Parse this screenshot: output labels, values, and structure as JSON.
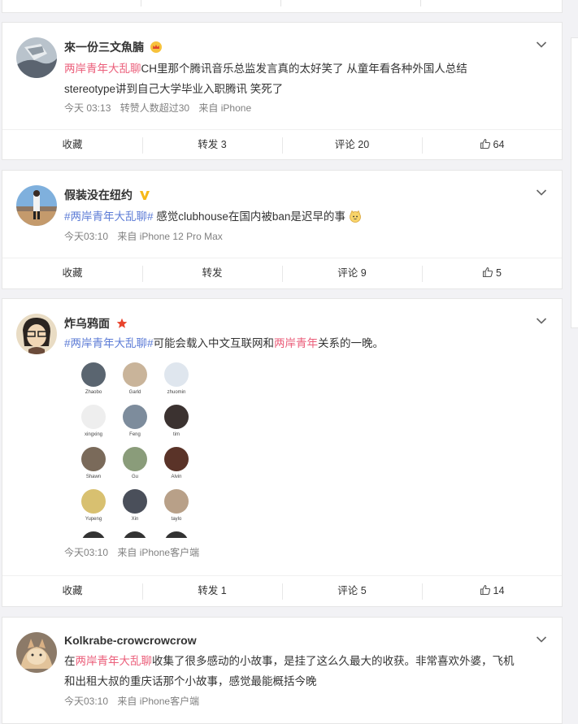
{
  "posts": [
    {
      "user": "來一份三文魚腩",
      "text_tag": "两岸青年大乱聊",
      "text_line1": "CH里那个腾讯音乐总监发言真的太好笑了 从童年看各种外国人总结",
      "text_line2": "stereotype讲到自己大学毕业入职腾讯 笑死了",
      "time": "今天 03:13",
      "extra": "转赞人数超过30",
      "source": "来自 iPhone",
      "actions": {
        "fav": "收藏",
        "repost": "转发 3",
        "comment": "评论 20",
        "like": "64"
      }
    },
    {
      "user": "假装没在纽约",
      "tag_full": "#两岸青年大乱聊#",
      "text": " 感觉clubhouse在国内被ban是迟早的事",
      "time": "今天03:10",
      "source": "来自 iPhone 12 Pro Max",
      "actions": {
        "fav": "收藏",
        "repost": "转发",
        "comment": "评论 9",
        "like": "5"
      }
    },
    {
      "user": "炸乌鸦面",
      "tag_full": "#两岸青年大乱聊#",
      "text_a": "可能会载入中文互联网和",
      "tag2": "两岸青年",
      "text_b": "关系的一晚。",
      "grid_names": [
        "Zhaobo",
        "Garld",
        "zhuomin",
        "xingxing",
        "Feng",
        "tim",
        "Shawn",
        "Gu",
        "Alvin",
        "Yupeng",
        "Xin",
        "taylo"
      ],
      "time": "今天03:10",
      "source": "来自 iPhone客户端",
      "actions": {
        "fav": "收藏",
        "repost": "转发 1",
        "comment": "评论 5",
        "like": "14"
      }
    },
    {
      "user": "Kolkrabe-crowcrowcrow",
      "text_a": "在",
      "tag": "两岸青年大乱聊",
      "text_b": "收集了很多感动的小故事，是挂了这么久最大的收获。非常喜欢外婆，飞机",
      "text_line2": "和出租大叔的重庆话那个小故事，感觉最能概括今晚",
      "time": "今天03:10",
      "source": "来自 iPhone客户端"
    }
  ],
  "icons": {
    "expand": "chevron-down-icon",
    "like": "thumbs-up-icon",
    "vip_gold": "crown-icon",
    "verified": "v-badge-icon",
    "star": "star-icon"
  }
}
